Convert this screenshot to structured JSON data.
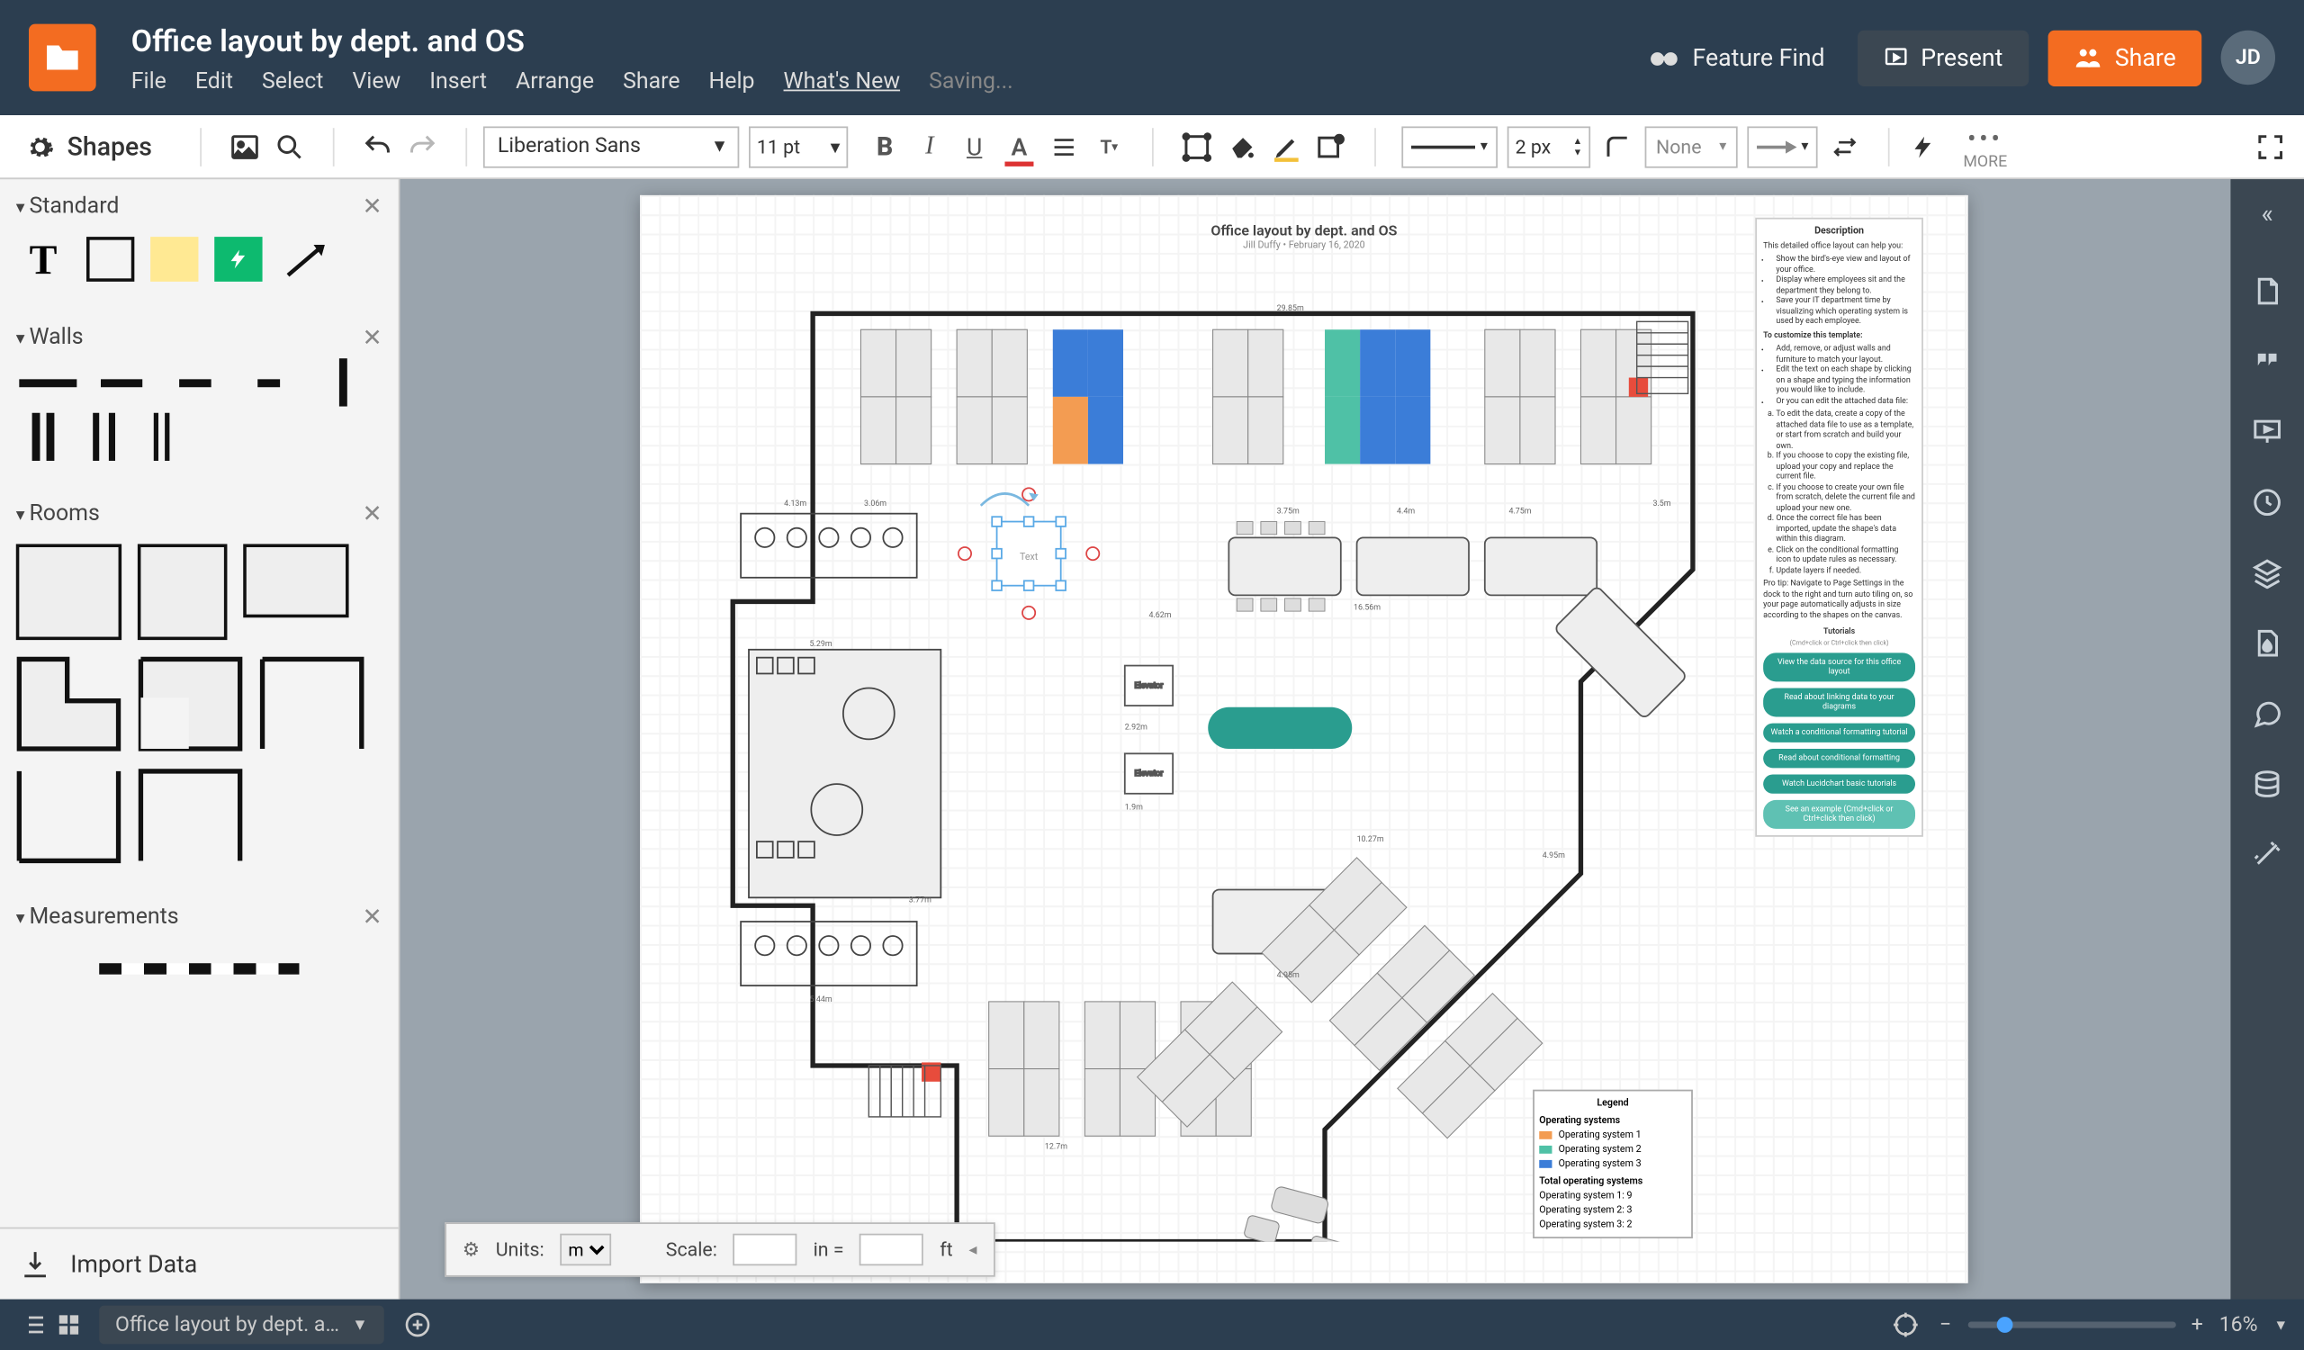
{
  "header": {
    "doc_title": "Office layout by dept. and OS",
    "menus": [
      "File",
      "Edit",
      "Select",
      "View",
      "Insert",
      "Arrange",
      "Share",
      "Help"
    ],
    "whats_new": "What's New",
    "saving": "Saving...",
    "feature_find": "Feature Find",
    "present": "Present",
    "share": "Share",
    "avatar": "JD"
  },
  "toolbar": {
    "shapes": "Shapes",
    "font": "Liberation Sans",
    "size": "11 pt",
    "stroke_px": "2 px",
    "endpoint": "None",
    "more": "MORE"
  },
  "left": {
    "sections": {
      "standard": "Standard",
      "walls": "Walls",
      "rooms": "Rooms",
      "measurements": "Measurements"
    },
    "import": "Import Data"
  },
  "scalebar": {
    "units_label": "Units:",
    "units_value": "m",
    "scale_label": "Scale:",
    "in_eq": "in =",
    "ft": "ft"
  },
  "canvas": {
    "title": "Office layout by dept. and OS",
    "subtitle": "Jill Duffy • February 16, 2020"
  },
  "legend": {
    "title": "Legend",
    "group1_title": "Operating systems",
    "os1": "Operating system 1",
    "os2": "Operating system 2",
    "os3": "Operating system 3",
    "group2_title": "Total operating systems",
    "t1": "Operating system 1:   9",
    "t2": "Operating system 2:   3",
    "t3": "Operating system 3:   2"
  },
  "description": {
    "title": "Description",
    "intro": "This detailed office layout can help you:",
    "bullets_a": [
      "Show the bird's-eye view and layout of your office.",
      "Display where employees sit and the department they belong to.",
      "Save your IT department time by visualizing which operating system is used by each employee."
    ],
    "custom_head": "To customize this template:",
    "bullets_b": [
      "Add, remove, or adjust walls and furniture to match your layout.",
      "Edit the text on each shape by clicking on a shape and typing the information you would like to include.",
      "Or you can edit the attached data file:"
    ],
    "bullets_c": [
      "To edit the data, create a copy of the attached data file to use as a template, or start from scratch and build your own.",
      "If you choose to copy the existing file, upload your copy and replace the current file.",
      "If you choose to create your own file from scratch, delete the current file and upload your new one.",
      "Once the correct file has been imported, update the shape's data within this diagram.",
      "Click on the conditional formatting icon to update rules as necessary.",
      "Update layers if needed."
    ],
    "protip": "Pro tip: Navigate to Page Settings in the dock to the right and turn auto tiling on, so your page automatically adjusts in size according to the shapes on the canvas.",
    "tut_head": "Tutorials",
    "tut_sub": "(Cmd+click or Ctrl+click then click)",
    "tut_btns": [
      "View the data source for this office layout",
      "Read about linking data to your diagrams",
      "Watch a conditional formatting tutorial",
      "Read about conditional formatting",
      "Watch Lucidchart basic tutorials",
      "See an example\n(Cmd+click or Ctrl+click then click)"
    ]
  },
  "bottom": {
    "tab": "Office layout by dept. a…",
    "zoom": "16%"
  }
}
